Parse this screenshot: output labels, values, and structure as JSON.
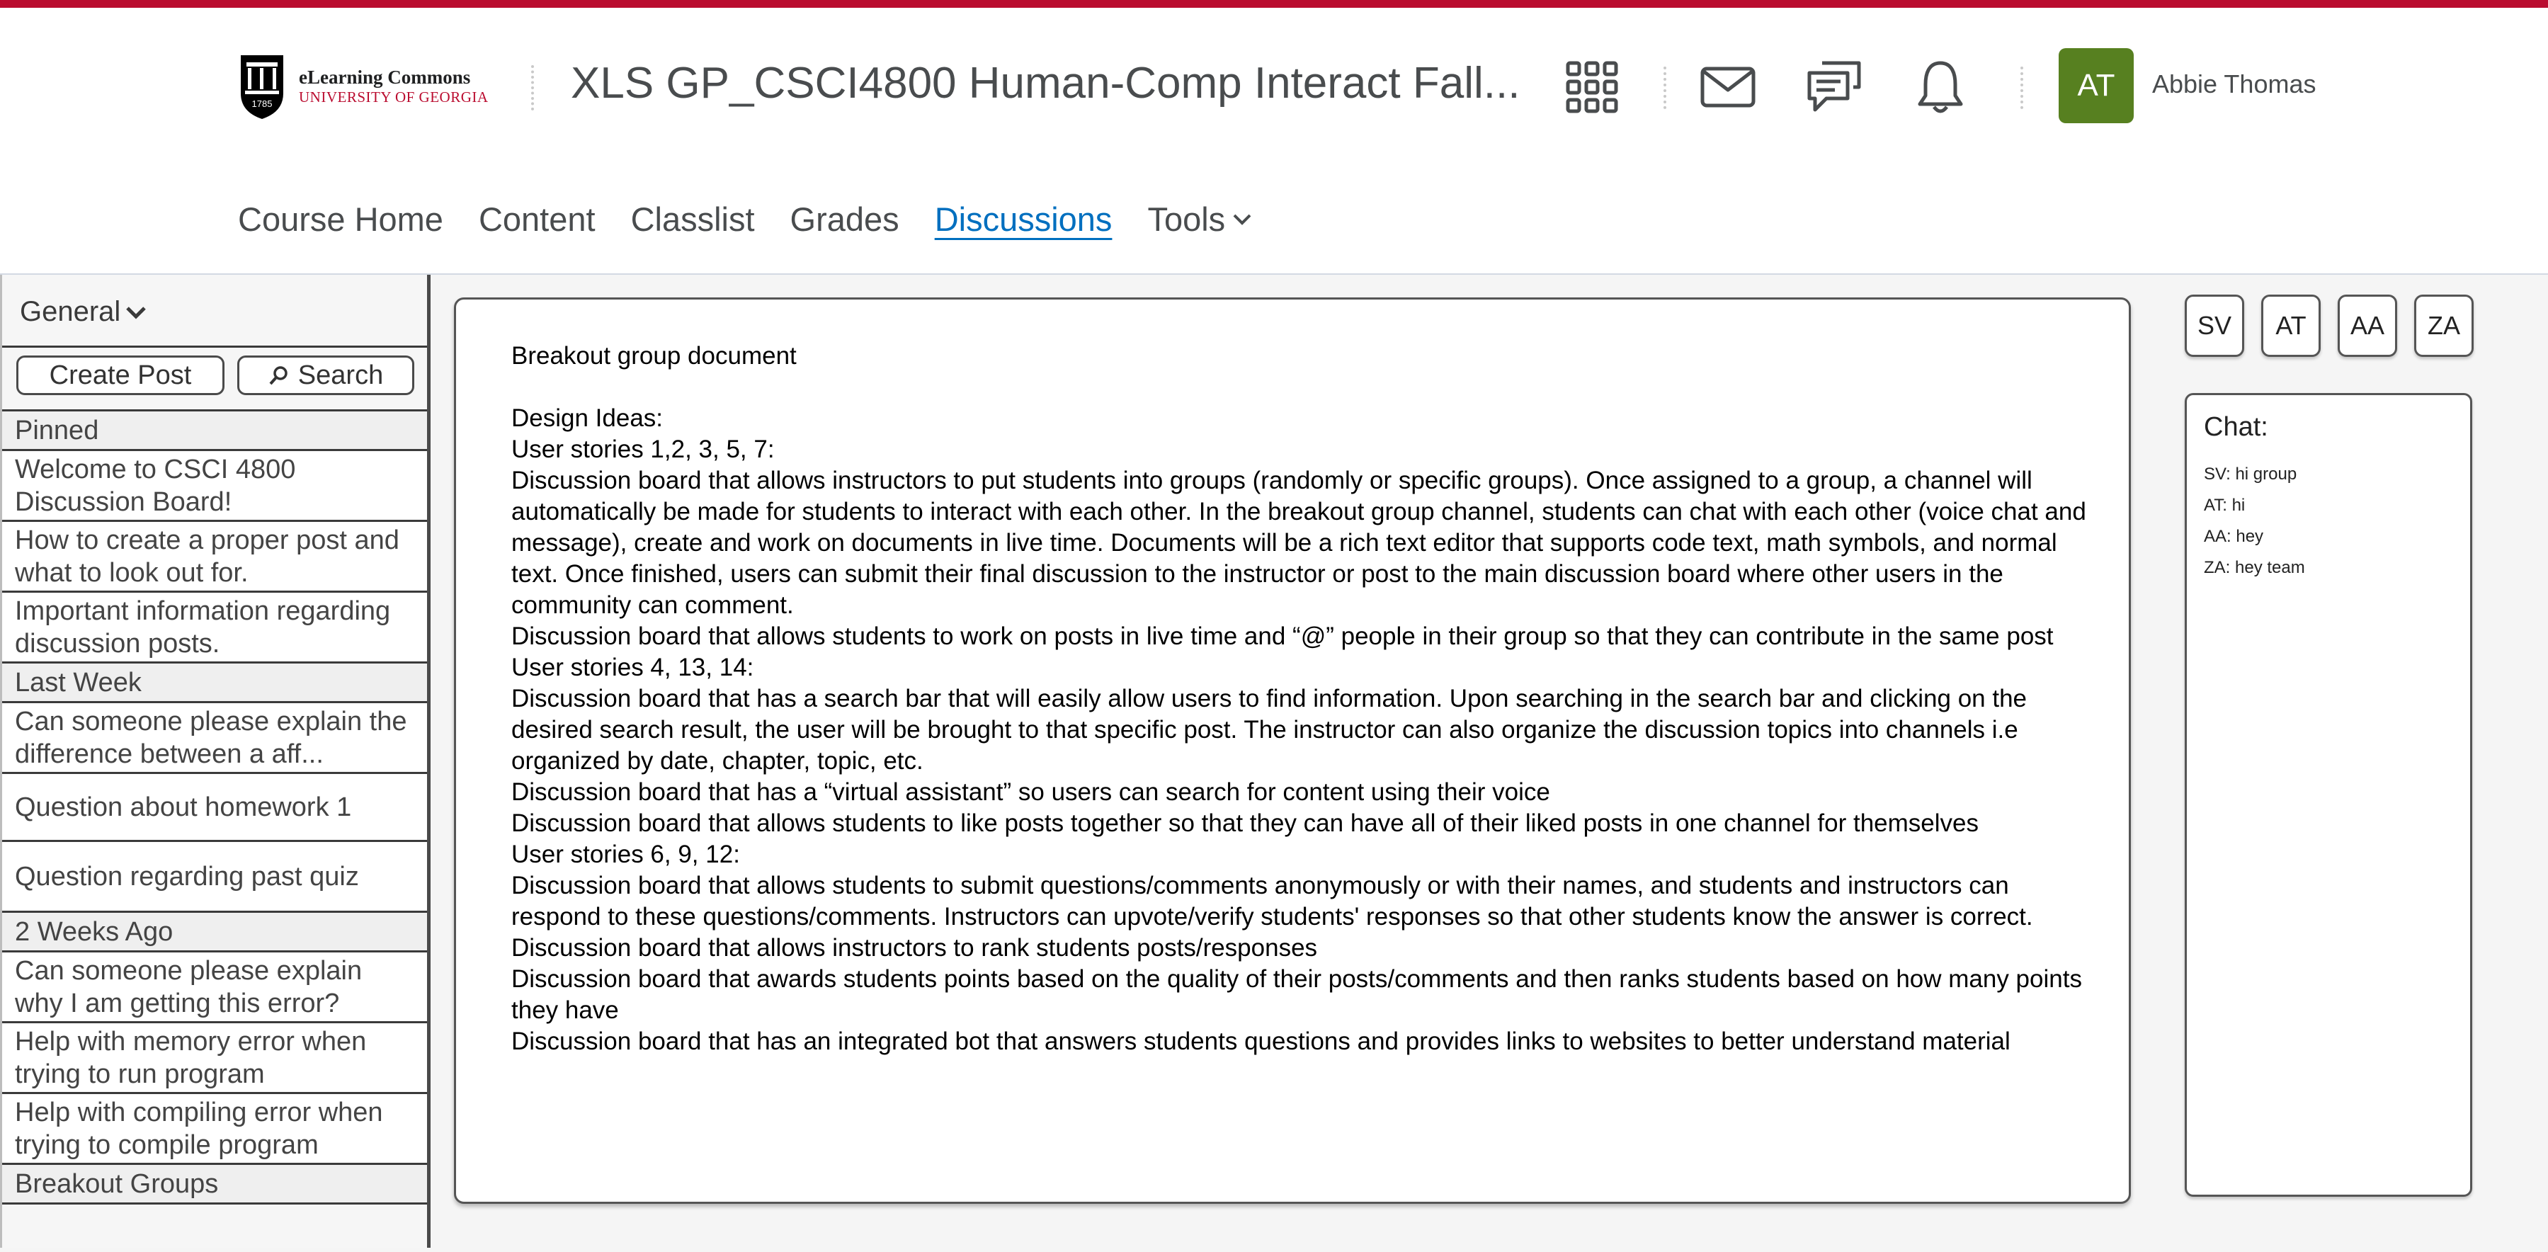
{
  "branding": {
    "line1": "eLearning Commons",
    "line2": "UNIVERSITY OF GEORGIA",
    "seal_year": "1785",
    "accent_color": "#ba0c2f"
  },
  "header": {
    "course_title": "XLS GP_CSCI4800 Human-Comp Interact Fall...",
    "icons": [
      "apps-grid-icon",
      "mail-icon",
      "chat-bubbles-icon",
      "bell-icon"
    ],
    "user_initials": "AT",
    "user_name": "Abbie Thomas",
    "avatar_color": "#578020"
  },
  "nav": {
    "items": [
      "Course Home",
      "Content",
      "Classlist",
      "Grades",
      "Discussions",
      "Tools"
    ],
    "active": "Discussions"
  },
  "sidebar": {
    "channel": "General",
    "create_post": "Create Post",
    "search": "Search",
    "rows": [
      {
        "type": "section",
        "text": "Pinned"
      },
      {
        "type": "post",
        "text": "Welcome to CSCI 4800 Discussion Board!"
      },
      {
        "type": "post",
        "text": "How to create a proper post and what to look out for."
      },
      {
        "type": "post",
        "text": "Important information regarding discussion posts."
      },
      {
        "type": "section",
        "text": "Last Week"
      },
      {
        "type": "post",
        "text": "Can someone please explain the difference between a aff..."
      },
      {
        "type": "post",
        "text": "Question about homework 1"
      },
      {
        "type": "post",
        "text": "Question regarding past quiz"
      },
      {
        "type": "section",
        "text": "2 Weeks Ago"
      },
      {
        "type": "post",
        "text": "Can someone please explain why I am getting this error?"
      },
      {
        "type": "post",
        "text": "Help with memory error when trying to run program"
      },
      {
        "type": "post",
        "text": "Help with compiling error when trying to compile program"
      },
      {
        "type": "section",
        "text": "Breakout Groups"
      }
    ]
  },
  "document": {
    "title": "Breakout group document",
    "lines": [
      "Design Ideas:",
      "User stories 1,2, 3, 5, 7:",
      "Discussion board that allows instructors to put students into groups (randomly or specific groups). Once assigned to a group, a channel will automatically be made for students to interact with each other. In the breakout group channel, students can chat with each other (voice chat and message), create and work on documents in live time. Documents will be a rich text editor that supports code text, math symbols, and normal text. Once finished, users can submit their final discussion to the instructor or post to the main discussion board where other users in the community can comment.",
      "Discussion board that allows students to work on posts in live time and “@” people in their group so that they can contribute in the same post",
      "User stories 4, 13, 14:",
      "Discussion board that has a search bar that will easily allow users to find information. Upon searching in the search bar and clicking on the desired search result, the user will be brought to that specific post. The instructor can also organize the discussion topics into channels i.e organized by date, chapter, topic, etc.",
      "Discussion board that has a “virtual assistant” so users can search for content using their voice",
      "Discussion board that allows students to like posts together so that they can have all of their liked posts in one channel for themselves",
      "User stories 6, 9, 12:",
      "Discussion board that allows students to submit questions/comments anonymously or with their names, and students and instructors can respond to these questions/comments. Instructors can upvote/verify students' responses so that other students know the answer is correct.",
      "Discussion board that allows instructors to rank students posts/responses",
      "Discussion board that awards students points based on the quality of their posts/comments and then ranks students based on how many points they have",
      "Discussion board that has an integrated bot that answers students questions and provides links to websites to better understand material"
    ]
  },
  "members": [
    "SV",
    "AT",
    "AA",
    "ZA"
  ],
  "chat": {
    "title": "Chat:",
    "messages": [
      "SV: hi group",
      "AT: hi",
      "AA: hey",
      "ZA: hey team"
    ]
  }
}
